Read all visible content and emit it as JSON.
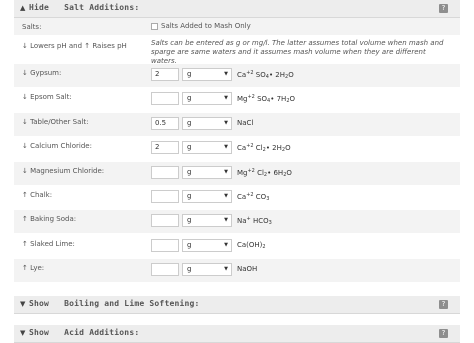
{
  "sections": {
    "salt": {
      "toggle": "▲",
      "title": "Hide   Salt Additions:",
      "help": "?"
    },
    "boiling": {
      "toggle": "▼",
      "title": "Show   Boiling and Lime Softening:",
      "help": "?"
    },
    "acid": {
      "toggle": "▼",
      "title": "Show   Acid Additions:",
      "help": "?"
    }
  },
  "salts_row": {
    "label": "Salts:",
    "checkbox_label": "Salts Added to Mash Only"
  },
  "ph_row": {
    "label": "↓ Lowers pH and ↑ Raises pH",
    "note": "Salts can be entered as g or mg/l. The latter assumes total volume when mash and sparge are same waters and it assumes mash volume when they are different waters."
  },
  "salts": [
    {
      "label": "↓ Gypsum:",
      "amount": "2",
      "unit": "g",
      "formula": "Ca<sup>+2</sup> SO<sub>4</sub>• 2H<sub>2</sub>O"
    },
    {
      "label": "↓ Epsom Salt:",
      "amount": "",
      "unit": "g",
      "formula": "Mg<sup>+2</sup> SO<sub>4</sub>• 7H<sub>2</sub>O"
    },
    {
      "label": "↓ Table/Other Salt:",
      "amount": "0.5",
      "unit": "g",
      "formula": "NaCl"
    },
    {
      "label": "↓ Calcium Chloride:",
      "amount": "2",
      "unit": "g",
      "formula": "Ca<sup>+2</sup> Cl<sub>2</sub>• 2H<sub>2</sub>O"
    },
    {
      "label": "↓ Magnesium Chloride:",
      "amount": "",
      "unit": "g",
      "formula": "Mg<sup>+2</sup> Cl<sub>2</sub>• 6H<sub>2</sub>O"
    },
    {
      "label": "↑ Chalk:",
      "amount": "",
      "unit": "g",
      "formula": "Ca<sup>+2</sup> CO<sub>3</sub>"
    },
    {
      "label": "↑ Baking Soda:",
      "amount": "",
      "unit": "g",
      "formula": "Na<sup>+</sup> HCO<sub>3</sub>"
    },
    {
      "label": "↑ Slaked Lime:",
      "amount": "",
      "unit": "g",
      "formula": "Ca(OH)<sub>2</sub>"
    },
    {
      "label": "↑ Lye:",
      "amount": "",
      "unit": "g",
      "formula": "NaOH"
    }
  ]
}
